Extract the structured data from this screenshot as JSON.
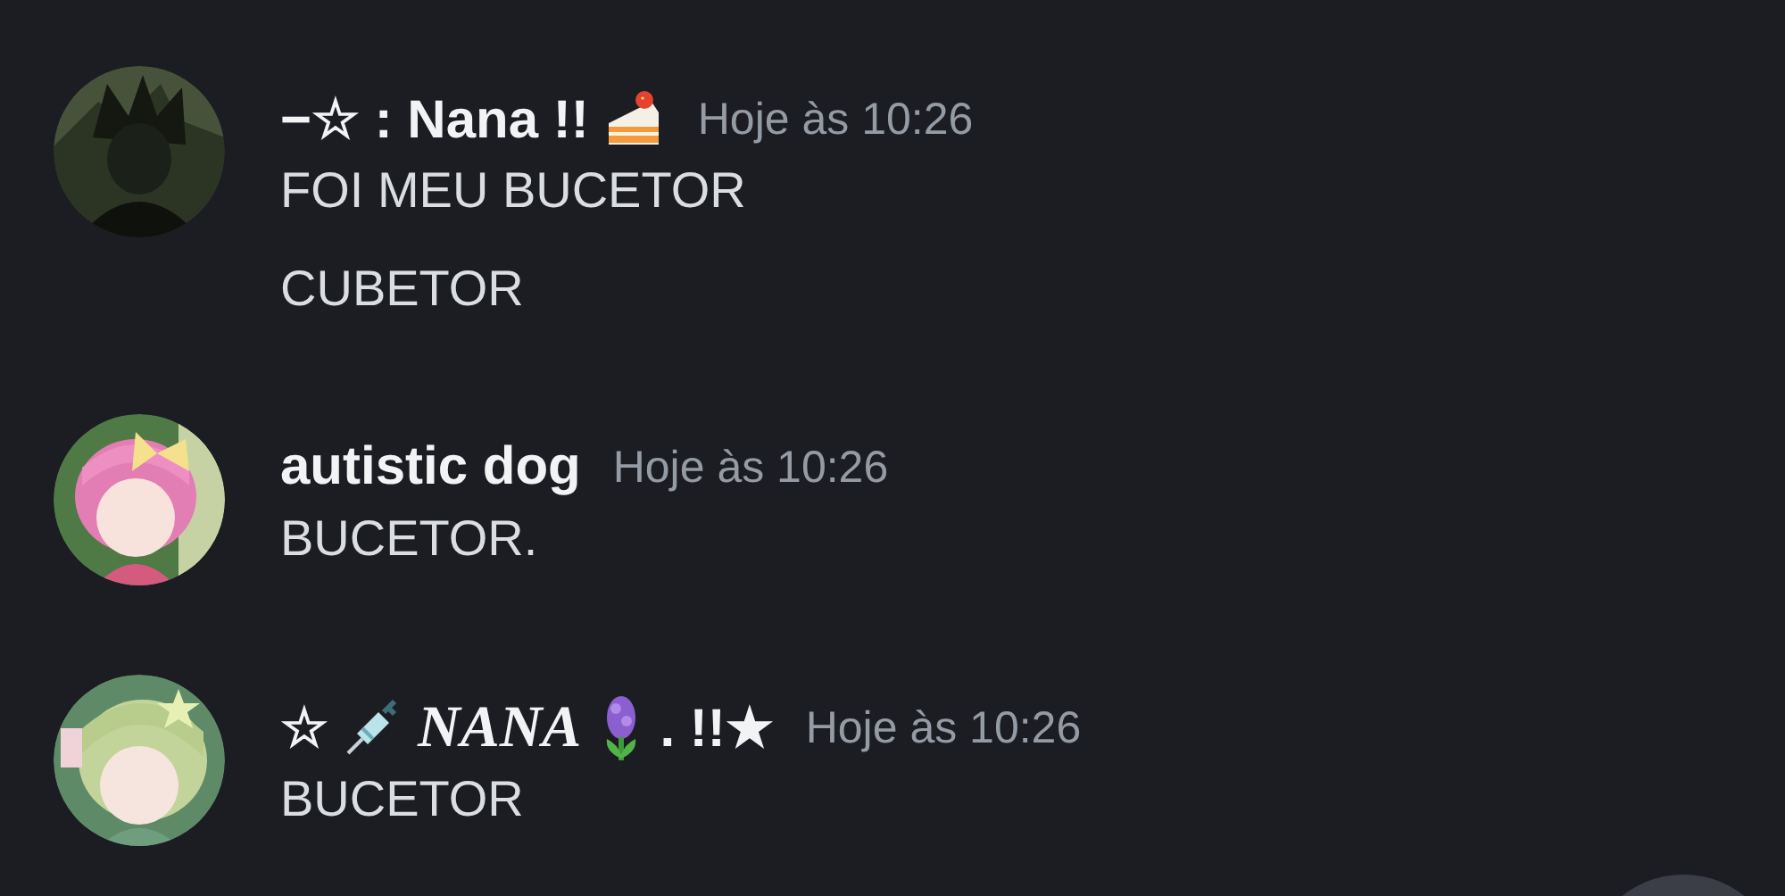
{
  "messages": [
    {
      "avatar": {
        "kind": "picture"
      },
      "author": [
        {
          "kind": "text",
          "text": "−☆ : Nana !!"
        },
        {
          "kind": "cake"
        }
      ],
      "timestamp": "Hoje às 10:26",
      "lines": [
        "FOI MEU BUCETOR",
        "CUBETOR"
      ]
    },
    {
      "avatar": {
        "kind": "picture"
      },
      "author": [
        {
          "kind": "text",
          "text": "autistic dog"
        }
      ],
      "timestamp": "Hoje às 10:26",
      "lines": [
        "BUCETOR."
      ]
    },
    {
      "avatar": {
        "kind": "picture"
      },
      "author": [
        {
          "kind": "text",
          "text": "☆"
        },
        {
          "kind": "syringe"
        },
        {
          "kind": "fancy",
          "text": "NANA"
        },
        {
          "kind": "flower"
        },
        {
          "kind": "text",
          "text": ". !!★"
        }
      ],
      "timestamp": "Hoje às 10:26",
      "lines": [
        "BUCETOR"
      ]
    }
  ]
}
